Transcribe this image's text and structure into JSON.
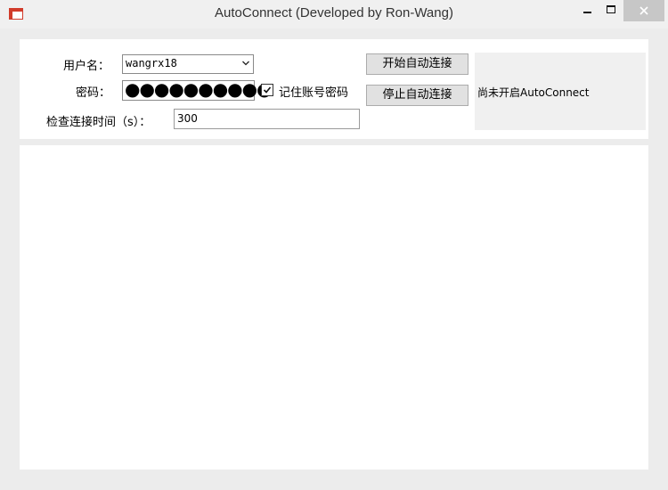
{
  "window": {
    "title": "AutoConnect (Developed by Ron-Wang)",
    "icon": "app-icon",
    "controls": [
      "minimize-icon",
      "maximize-icon",
      "close-icon"
    ]
  },
  "form": {
    "username_label": "用户名：",
    "username_value": "wangrx18",
    "password_label": "密码：",
    "password_masked": "●●●●●●●●●●",
    "remember_label": "记住账号密码",
    "remember_checked": true,
    "interval_label": "检查连接时间（s）：",
    "interval_value": "300"
  },
  "buttons": {
    "start_label": "开始自动连接",
    "stop_label": "停止自动连接"
  },
  "status": {
    "text": "尚未开启AutoConnect"
  },
  "log": {
    "content": ""
  },
  "colors": {
    "window_bg": "#ececec",
    "panel_bg": "#ffffff",
    "button_bg": "#e1e1e1",
    "status_bg": "#f0f0f0",
    "close_button_bg": "#c7c7c7"
  }
}
